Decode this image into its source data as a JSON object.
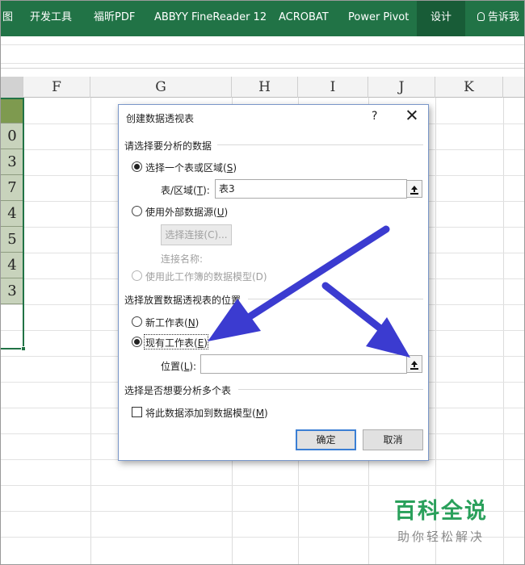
{
  "ribbon": {
    "tabs": [
      {
        "label": "图"
      },
      {
        "label": "开发工具"
      },
      {
        "label": "福昕PDF"
      },
      {
        "label": "ABBYY FineReader 12"
      },
      {
        "label": "ACROBAT"
      },
      {
        "label": "Power Pivot"
      },
      {
        "label": "设计",
        "active": true
      },
      {
        "label": "告诉我"
      }
    ],
    "tell_me_icon": "lightbulb-icon",
    "color": "#217346",
    "active_color": "#185c37"
  },
  "sheet": {
    "columns": [
      "F",
      "G",
      "H",
      "I",
      "J",
      "K"
    ],
    "partial_column_values": [
      "0",
      "3",
      "7",
      "4",
      "5",
      "4",
      "3"
    ],
    "header_cell_color": "#7e9a4f",
    "data_cell_color": "#c8d3bc"
  },
  "dialog": {
    "title": "创建数据透视表",
    "help": "?",
    "close_icon": "close-icon",
    "section_data": "请选择要分析的数据",
    "opt_table": {
      "text": "选择一个表或区域(",
      "key": "S",
      "end": ")",
      "selected": true
    },
    "range_label": {
      "text": "表/区域(",
      "key": "T",
      "end": "):"
    },
    "range_value": "表3",
    "opt_external": {
      "text": "使用外部数据源(",
      "key": "U",
      "end": ")",
      "selected": false
    },
    "choose_connection_label": "选择连接(C)...",
    "connection_name_label": "连接名称:",
    "opt_datamodel": {
      "label": "使用此工作簿的数据模型(D)",
      "disabled": true
    },
    "section_location": "选择放置数据透视表的位置",
    "opt_new_sheet": {
      "text": "新工作表(",
      "key": "N",
      "end": ")",
      "selected": false
    },
    "opt_existing_sheet": {
      "text": "现有工作表(",
      "key": "E",
      "end": ")",
      "selected": true
    },
    "location_label": {
      "text": "位置(",
      "key": "L",
      "end": "):"
    },
    "location_value": "",
    "section_multi": "选择是否想要分析多个表",
    "add_model": {
      "text": "将此数据添加到数据模型(",
      "key": "M",
      "end": ")",
      "checked": false
    },
    "ok_label": "确定",
    "cancel_label": "取消",
    "collapse_icon": "collapse-dialog-icon"
  },
  "annotation": {
    "arrow_color": "#3b3bd0"
  },
  "watermark": {
    "line1": "百科全说",
    "line2": "助你轻松解决",
    "color": "#2aa05b"
  }
}
